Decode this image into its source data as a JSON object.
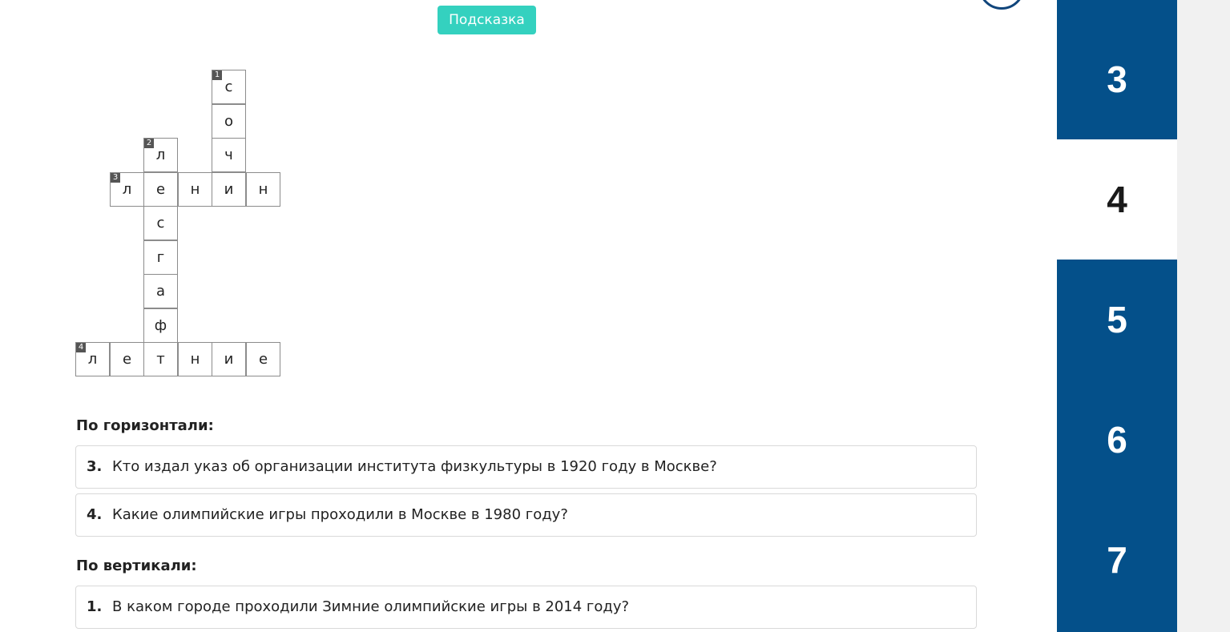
{
  "hint_button": {
    "label": "Подсказка"
  },
  "crossword": {
    "row1_cells": [
      "с"
    ],
    "row2_cells": [
      "о"
    ],
    "row3_cells": [
      "л",
      "ч"
    ],
    "row4_cells": [
      "л",
      "е",
      "н",
      "и",
      "н"
    ],
    "row5_cells": [
      "с"
    ],
    "row6_cells": [
      "г"
    ],
    "row7_cells": [
      "а"
    ],
    "row8_cells": [
      "ф"
    ],
    "row9_cells": [
      "л",
      "е",
      "т",
      "н",
      "и",
      "е"
    ],
    "clue_numbers": [
      "1",
      "2",
      "3",
      "4"
    ]
  },
  "horizontal": {
    "title": "По горизонтали:",
    "questions": [
      {
        "num": "3.",
        "text": "Кто издал указ об организации института физкультуры в 1920 году в Москве?"
      },
      {
        "num": "4.",
        "text": "Какие олимпийские игры проходили в Москве в 1980 году?"
      }
    ]
  },
  "vertical": {
    "title": "По вертикали:",
    "questions": [
      {
        "num": "1.",
        "text": "В каком городе проходили Зимние олимпийские игры в 2014 году?"
      }
    ]
  },
  "sidebar": {
    "items": [
      "3",
      "4",
      "5",
      "6",
      "7"
    ],
    "active": "4",
    "accent_color": "#04508a"
  },
  "colors": {
    "hint_button": "#34d1bf",
    "circle_icon": "#10457b"
  }
}
